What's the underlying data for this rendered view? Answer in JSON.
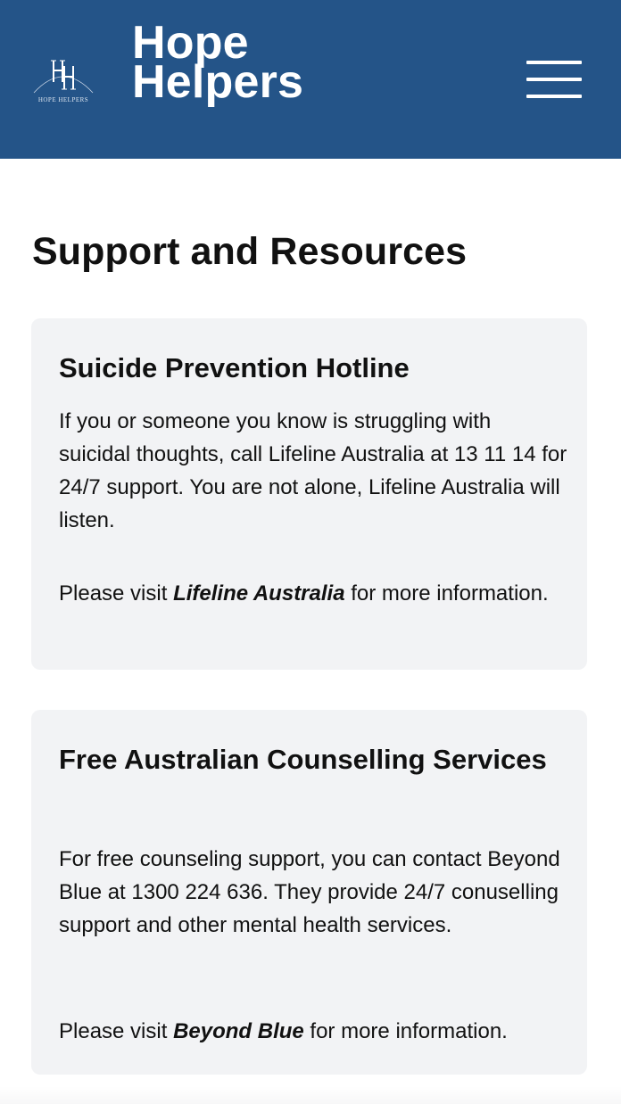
{
  "header": {
    "logo_mark": "HH",
    "logo_caption": "HOPE HELPERS",
    "brand_line1": "Hope",
    "brand_line2": "Helpers",
    "menu_icon": "hamburger-icon"
  },
  "page": {
    "title": "Support and Resources"
  },
  "cards": [
    {
      "title": "Suicide Prevention Hotline",
      "body": "If you or someone you know is struggling with suicidal thoughts, call Lifeline Australia at 13 11 14 for 24/7 support. You are not alone, Lifeline Australia will listen.",
      "visit_prefix": "Please visit ",
      "link_text": "Lifeline Australia",
      "visit_suffix": " for more information."
    },
    {
      "title": "Free Australian Counselling Services",
      "body": "For free counseling support, you can contact Beyond Blue at 1300 224 636. They provide 24/7 conuselling support and other mental health services.",
      "visit_prefix": "Please visit ",
      "link_text": "Beyond Blue",
      "visit_suffix": " for more information."
    }
  ],
  "colors": {
    "header_bg": "#245488",
    "card_bg": "#f2f3f5"
  }
}
